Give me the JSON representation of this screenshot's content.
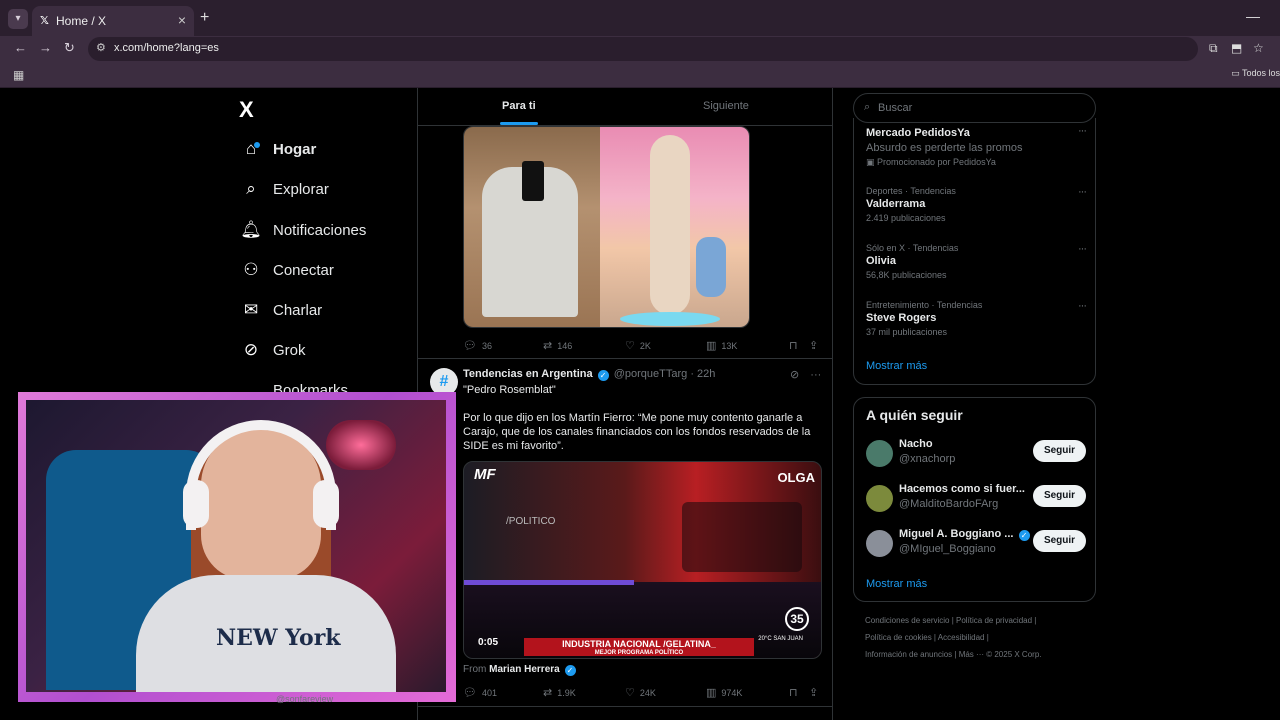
{
  "browser": {
    "tab_title": "Home / X",
    "url": "x.com/home?lang=es",
    "bookmarks_all": "Todos los"
  },
  "nav": {
    "logo": "X",
    "items": [
      {
        "label": "Hogar",
        "icon": "home-icon"
      },
      {
        "label": "Explorar",
        "icon": "search-icon"
      },
      {
        "label": "Notificaciones",
        "icon": "bell-icon"
      },
      {
        "label": "Conectar",
        "icon": "add-user-icon"
      },
      {
        "label": "Charlar",
        "icon": "mail-icon"
      },
      {
        "label": "Grok",
        "icon": "grok-icon"
      },
      {
        "label": "Bookmarks",
        "icon": "bookmark-icon"
      }
    ]
  },
  "feed": {
    "tabs": [
      "Para ti",
      "Siguiente"
    ],
    "tweet1_actions": {
      "replies": "36",
      "reposts": "146",
      "likes": "2K",
      "views": "13K"
    },
    "tweet2": {
      "name": "Tendencias en Argentina",
      "handle": "@porqueTTarg",
      "time": "· 22h",
      "quote": "\"Pedro Rosemblat\"",
      "text": "Por lo que dijo en los Martín Fierro: “Me pone muy contento ganarle a Carajo, que de los canales financiados con los fondos reservados de la SIDE es mi favorito”.",
      "video": {
        "logo": "MF",
        "channel": "OLGA",
        "politico": "/POLITICO",
        "banner": "INDUSTRIA NACIONAL /GELATINA_",
        "banner_sub": "MEJOR PROGRAMA POLÍTICO",
        "badge": "35",
        "time": "0:05",
        "temp": "20°C SAN JUAN"
      },
      "from_label": "From",
      "from_name": "Marian Herrera",
      "actions": {
        "replies": "401",
        "reposts": "1.9K",
        "likes": "24K",
        "views": "974K"
      }
    }
  },
  "search": {
    "placeholder": "Buscar"
  },
  "trends": [
    {
      "meta": "",
      "name": "Mercado PedidosYa",
      "extra": "Absurdo es perderte las promos",
      "count": "Promocionado por PedidosYa"
    },
    {
      "meta": "Deportes · Tendencias",
      "name": "Valderrama",
      "count": "2.419 publicaciones"
    },
    {
      "meta": "Sólo en X · Tendencias",
      "name": "Olivia",
      "count": "56,8K publicaciones"
    },
    {
      "meta": "Entretenimiento · Tendencias",
      "name": "Steve Rogers",
      "count": "37 mil publicaciones"
    }
  ],
  "trends_show_more": "Mostrar más",
  "who_to_follow": {
    "title": "A quién seguir",
    "users": [
      {
        "name": "Nacho",
        "handle": "@xnachorp",
        "button": "Seguir",
        "avatar_color": "#4a7a6a",
        "verified": false
      },
      {
        "name": "Hacemos como si fuer...",
        "handle": "@MalditoBardoFArg",
        "button": "Seguir",
        "avatar_color": "#7c8a3c",
        "verified": false
      },
      {
        "name": "Miguel A. Boggiano ...",
        "handle": "@MIguel_Boggiano",
        "button": "Seguir",
        "avatar_color": "#8a8f99",
        "verified": true
      }
    ],
    "show_more": "Mostrar más"
  },
  "footer": {
    "line1": "Condiciones de servicio  |  Política de privacidad  |",
    "line2": "Política de cookies  |  Accesibilidad  |",
    "line3": "Información de anuncios  |  Más ···  © 2025 X Corp."
  },
  "streamer": {
    "shirt_text": "NEW York",
    "peek_text": "@sonfareview"
  },
  "colors": {
    "accent": "#1d9bf0",
    "cam_border": "#d46ad6",
    "follow_bg": "#eff3f4"
  }
}
